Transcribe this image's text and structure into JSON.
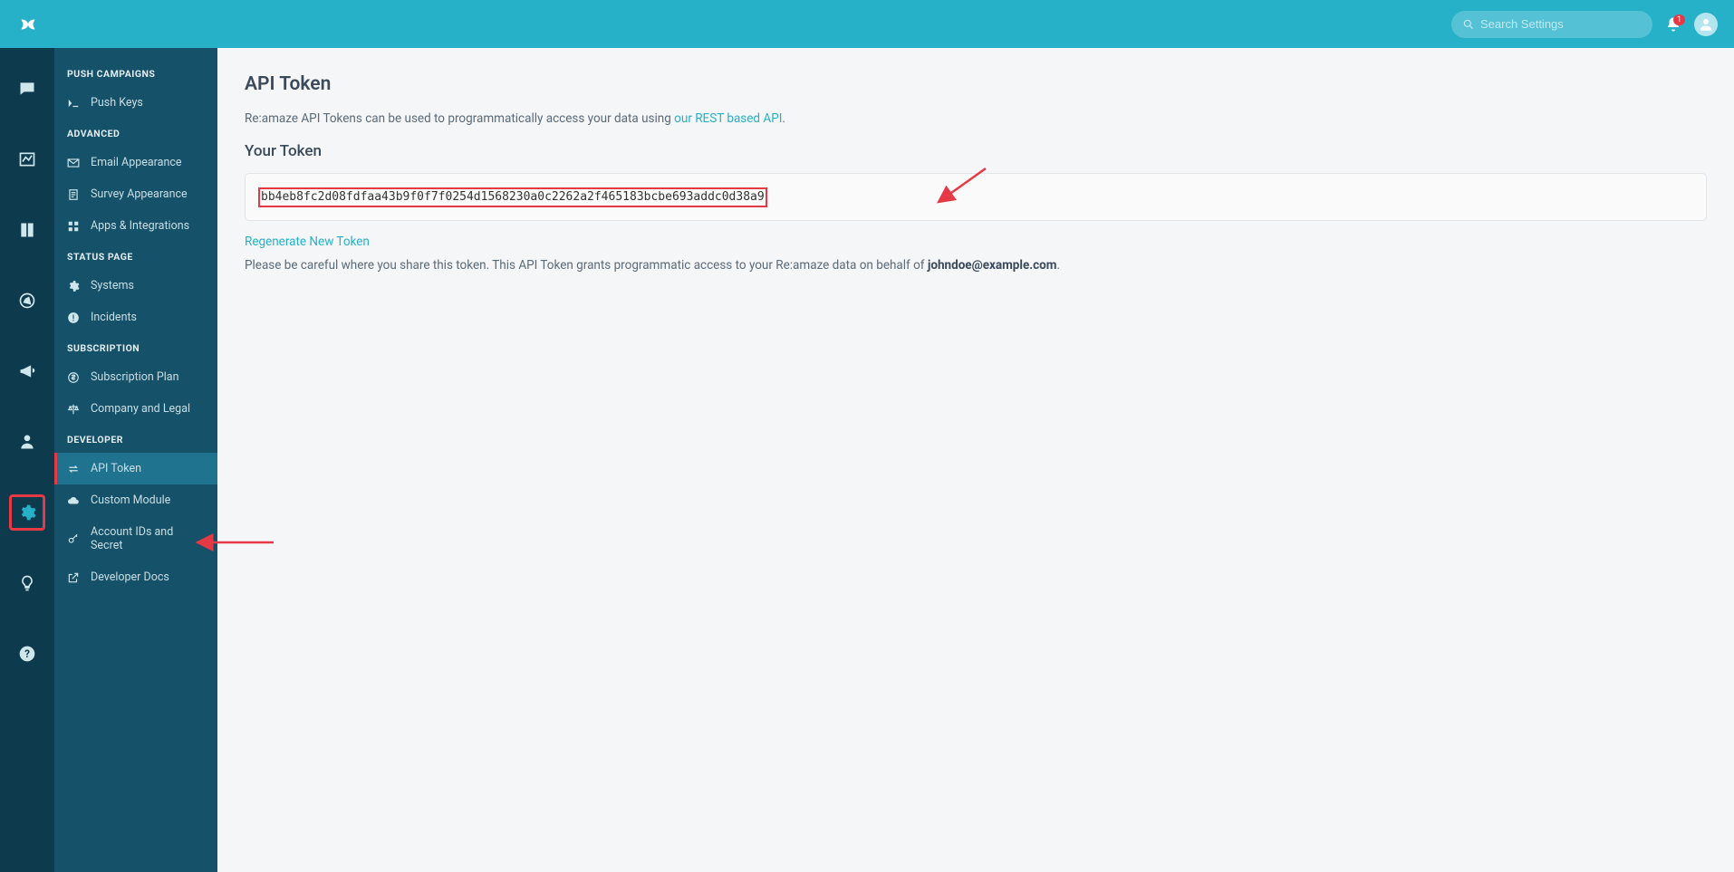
{
  "header": {
    "search_placeholder": "Search Settings",
    "notification_count": "1"
  },
  "sidebar": {
    "sections": [
      {
        "title": "PUSH CAMPAIGNS",
        "items": [
          {
            "label": "Push Keys",
            "icon": "terminal-icon"
          }
        ]
      },
      {
        "title": "ADVANCED",
        "items": [
          {
            "label": "Email Appearance",
            "icon": "mail-icon"
          },
          {
            "label": "Survey Appearance",
            "icon": "clipboard-icon"
          },
          {
            "label": "Apps & Integrations",
            "icon": "grid-icon"
          }
        ]
      },
      {
        "title": "STATUS PAGE",
        "items": [
          {
            "label": "Systems",
            "icon": "gear-icon"
          },
          {
            "label": "Incidents",
            "icon": "alert-icon"
          }
        ]
      },
      {
        "title": "SUBSCRIPTION",
        "items": [
          {
            "label": "Subscription Plan",
            "icon": "dollar-icon"
          },
          {
            "label": "Company and Legal",
            "icon": "scale-icon"
          }
        ]
      },
      {
        "title": "DEVELOPER",
        "items": [
          {
            "label": "API Token",
            "icon": "swap-icon",
            "active": true
          },
          {
            "label": "Custom Module",
            "icon": "cloud-icon"
          },
          {
            "label": "Account IDs and Secret",
            "icon": "key-icon"
          },
          {
            "label": "Developer Docs",
            "icon": "external-link-icon"
          }
        ]
      }
    ]
  },
  "main": {
    "title": "API Token",
    "desc_prefix": "Re:amaze API Tokens can be used to programmatically access your data using ",
    "desc_link": "our REST based API",
    "desc_suffix": ".",
    "your_token_heading": "Your Token",
    "token": "bb4eb8fc2d08fdfaa43b9f0f7f0254d1568230a0c2262a2f465183bcbe693addc0d38a9",
    "regenerate_label": "Regenerate New Token",
    "warning_prefix": "Please be careful where you share this token. This API Token grants programmatic access to your Re:amaze data on behalf of ",
    "warning_email": "johndoe@example.com",
    "warning_suffix": "."
  },
  "colors": {
    "accent": "#26b1c9",
    "danger": "#e63946",
    "dark": "#0d3b4d",
    "sidebar": "#155269"
  }
}
